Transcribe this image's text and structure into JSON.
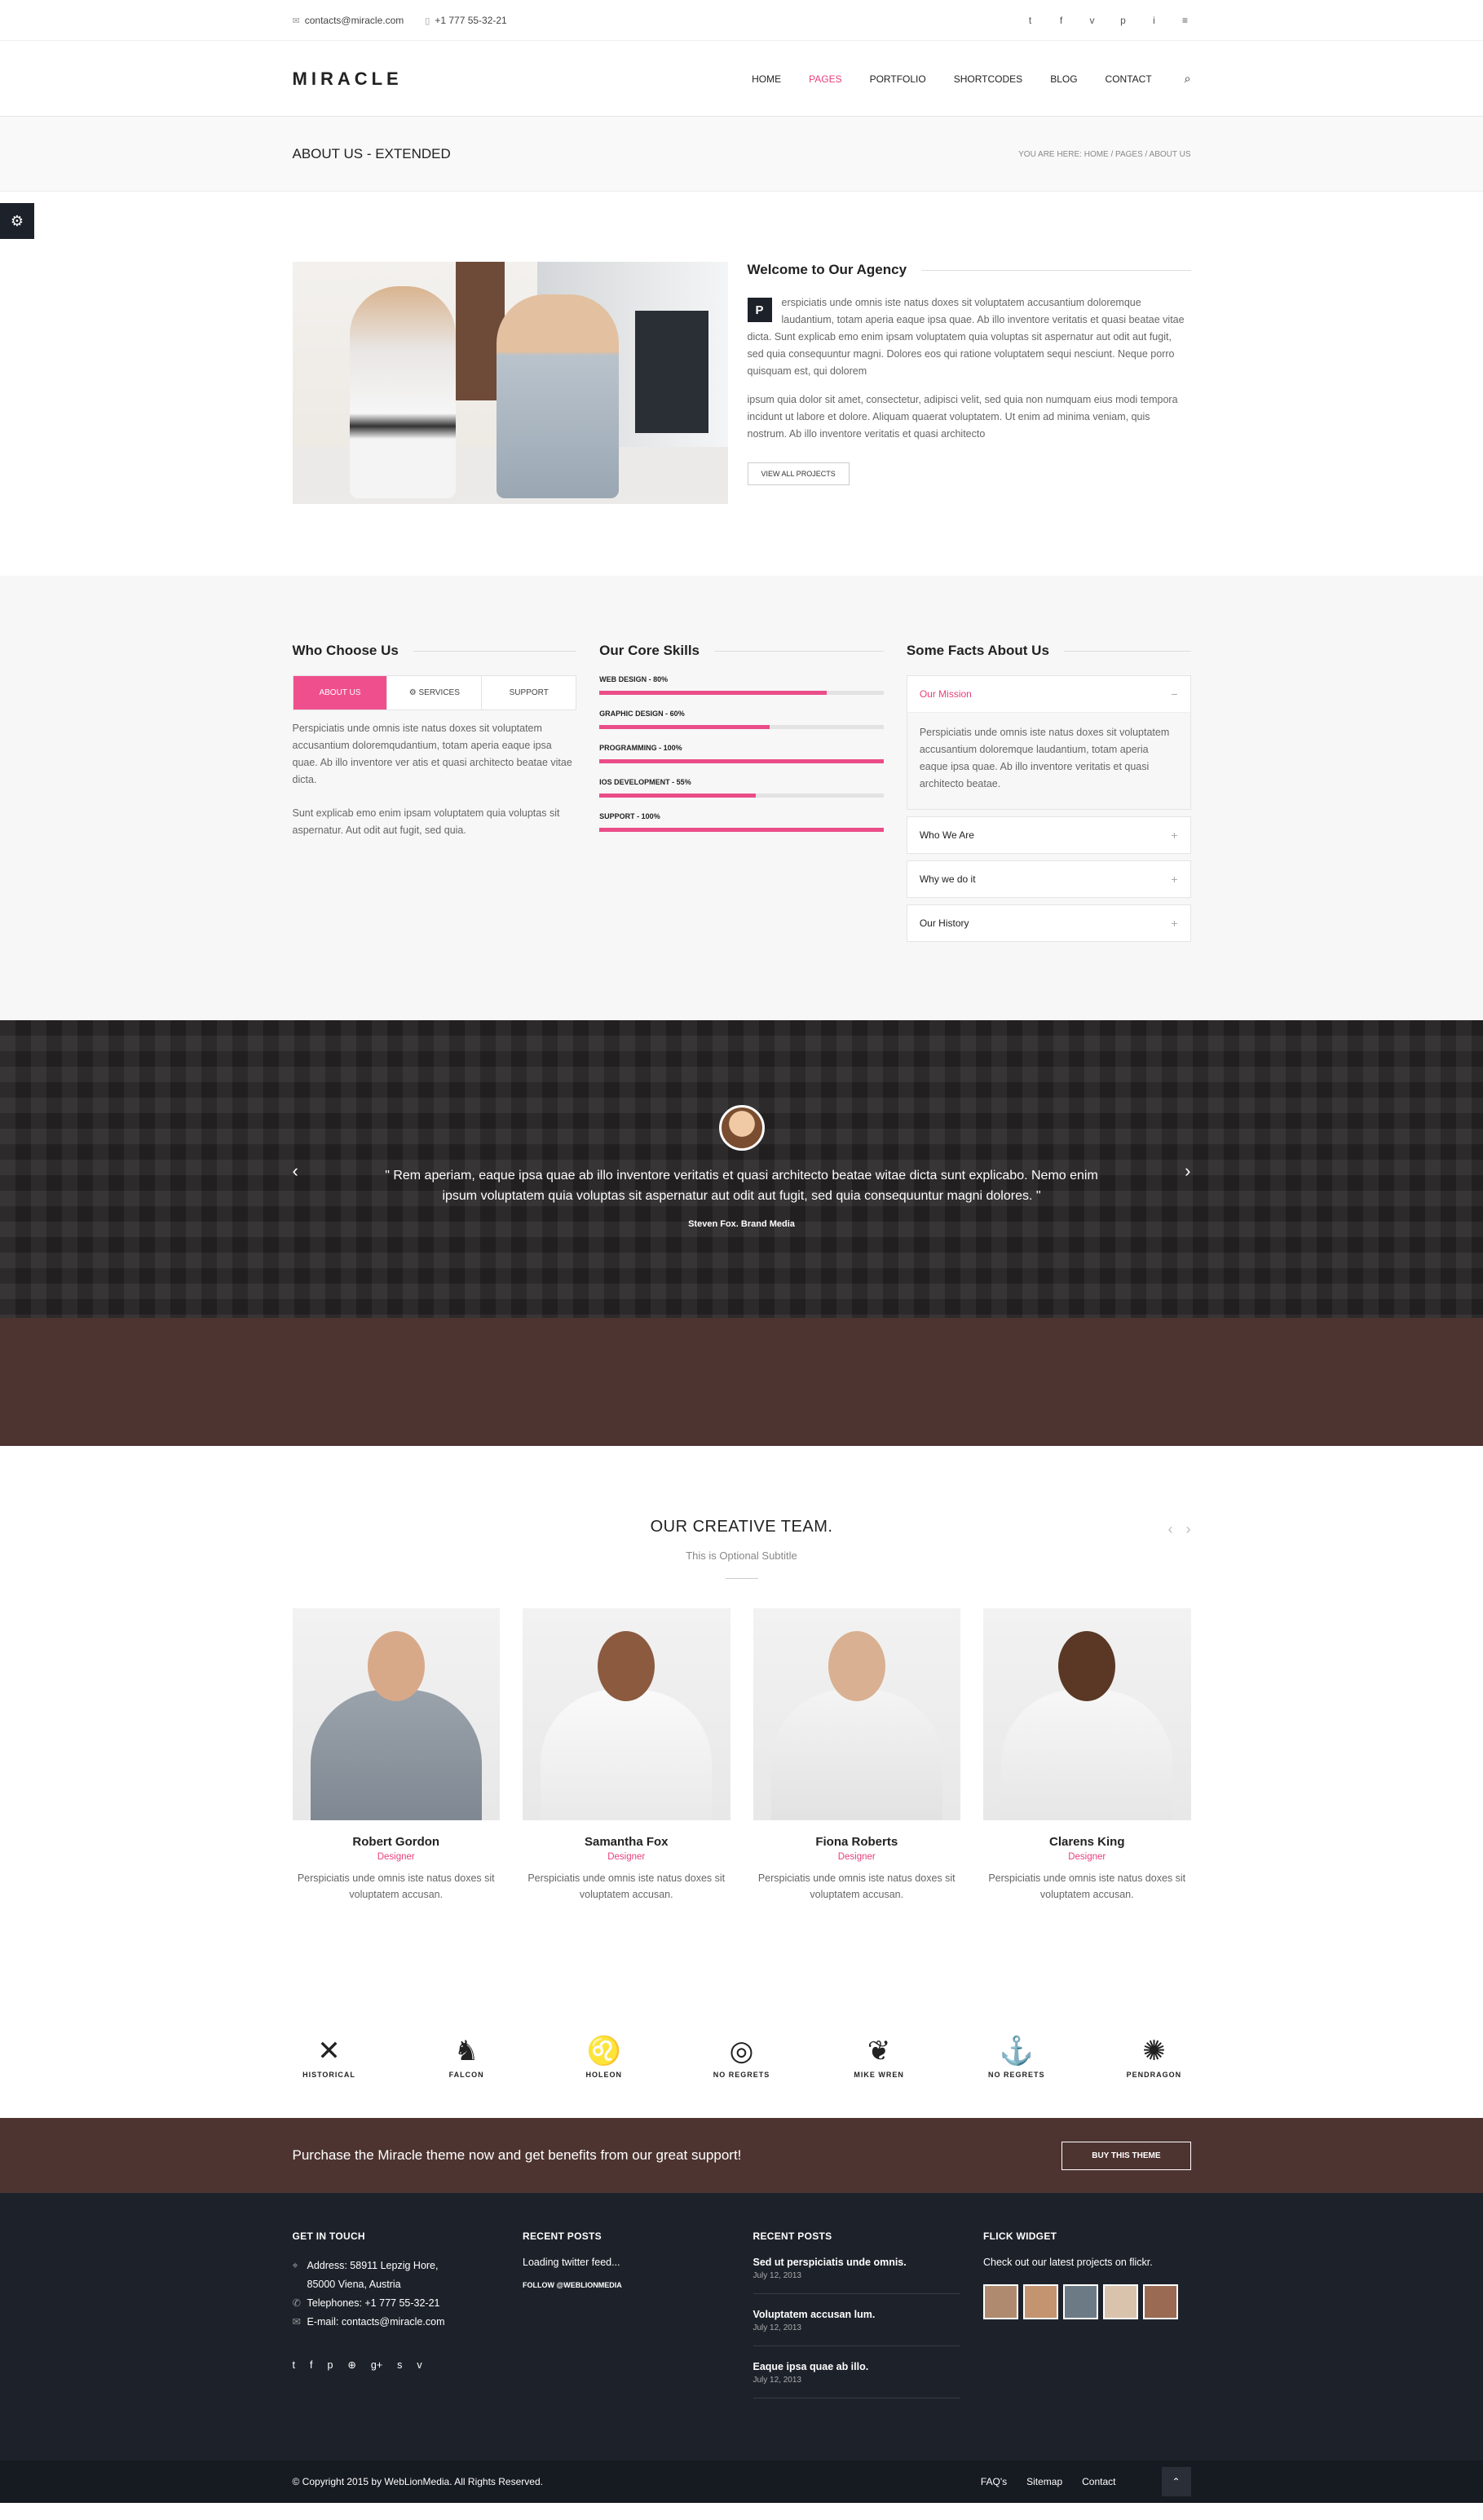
{
  "topbar": {
    "email": "contacts@miracle.com",
    "phone": "+1 777 55-32-21",
    "social": [
      "t",
      "f",
      "v",
      "p",
      "i",
      "≡"
    ]
  },
  "header": {
    "logo": "MIRACLE",
    "nav": [
      "HOME",
      "PAGES",
      "PORTFOLIO",
      "SHORTCODES",
      "BLOG",
      "CONTACT"
    ],
    "active": "PAGES"
  },
  "titlebar": {
    "title": "ABOUT US - EXTENDED",
    "breadcrumb": "YOU ARE HERE: HOME / PAGES / ABOUT US"
  },
  "about": {
    "title": "Welcome to Our Agency",
    "dropcap": "P",
    "para1": "erspiciatis unde omnis iste natus doxes sit voluptatem accusantium doloremque laudantium, totam aperia eaque ipsa quae. Ab illo inventore veritatis et quasi beatae vitae dicta. Sunt explicab emo enim ipsam voluptatem quia voluptas sit aspernatur aut odit aut fugit, sed quia consequuntur magni. Dolores eos qui ratione voluptatem sequi nesciunt. Neque porro quisquam est, qui dolorem",
    "para2": "ipsum quia dolor sit amet, consectetur, adipisci velit, sed quia non numquam eius modi tempora incidunt ut labore et dolore. Aliquam quaerat voluptatem. Ut enim ad minima veniam, quis nostrum. Ab illo inventore veritatis et quasi architecto",
    "button": "VIEW ALL PROJECTS"
  },
  "features": {
    "who": {
      "title": "Who Choose Us",
      "tabs": [
        "ABOUT US",
        "⚙ SERVICES",
        "SUPPORT"
      ],
      "p1": "Perspiciatis unde omnis iste natus doxes sit voluptatem accusantium doloremqudantium, totam aperia eaque ipsa quae. Ab illo inventore ver atis et quasi architecto beatae vitae dicta.",
      "p2": "Sunt explicab emo enim ipsam voluptatem quia voluptas sit aspernatur. Aut odit aut fugit, sed quia."
    },
    "skills": {
      "title": "Our Core Skills",
      "items": [
        {
          "label": "WEB DESIGN - 80%",
          "value": 80
        },
        {
          "label": "GRAPHIC DESIGN - 60%",
          "value": 60
        },
        {
          "label": "PROGRAMMING - 100%",
          "value": 100
        },
        {
          "label": "IOS DEVELOPMENT - 55%",
          "value": 55
        },
        {
          "label": "SUPPORT - 100%",
          "value": 100
        }
      ]
    },
    "facts": {
      "title": "Some Facts About Us",
      "open": "Our Mission",
      "open_body": "Perspiciatis unde omnis iste natus doxes sit voluptatem accusantium doloremque laudantium, totam aperia eaque ipsa quae. Ab illo inventore veritatis et quasi architecto beatae.",
      "closed": [
        "Who We Are",
        "Why we do it",
        "Our History"
      ]
    }
  },
  "testimonial": {
    "quote": "\" Rem aperiam, eaque ipsa quae ab illo inventore veritatis et quasi architecto beatae witae dicta sunt explicabo. Nemo enim ipsum voluptatem quia voluptas sit aspernatur aut odit aut fugit, sed quia consequuntur magni dolores. \"",
    "author": "Steven Fox. Brand Media"
  },
  "team": {
    "title": "OUR CREATIVE TEAM.",
    "subtitle": "This is Optional Subtitle",
    "members": [
      {
        "name": "Robert Gordon",
        "role": "Designer",
        "desc": "Perspiciatis unde omnis iste natus doxes sit voluptatem accusan."
      },
      {
        "name": "Samantha Fox",
        "role": "Designer",
        "desc": "Perspiciatis unde omnis iste natus doxes sit voluptatem accusan."
      },
      {
        "name": "Fiona Roberts",
        "role": "Designer",
        "desc": "Perspiciatis unde omnis iste natus doxes sit voluptatem accusan."
      },
      {
        "name": "Clarens King",
        "role": "Designer",
        "desc": "Perspiciatis unde omnis iste natus doxes sit voluptatem accusan."
      }
    ]
  },
  "logos": [
    {
      "mark": "✕",
      "name": "HISTORICAL"
    },
    {
      "mark": "♞",
      "name": "FALCON"
    },
    {
      "mark": "♌",
      "name": "HOLEON"
    },
    {
      "mark": "◎",
      "name": "NO REGRETS"
    },
    {
      "mark": "❦",
      "name": "MIKE WREN"
    },
    {
      "mark": "⚓",
      "name": "NO REGRETS"
    },
    {
      "mark": "✺",
      "name": "PENDRAGON"
    }
  ],
  "cta": {
    "text": "Purchase the Miracle theme now and get benefits from our great support!",
    "button": "BUY THIS THEME"
  },
  "footer": {
    "contact": {
      "title": "GET IN TOUCH",
      "address1": "Address: 58911 Lepzig Hore,",
      "address2": "85000 Viena, Austria",
      "phone": "Telephones: +1 777 55-32-21",
      "email": "E-mail: contacts@miracle.com",
      "social": [
        "t",
        "f",
        "p",
        "⊕",
        "g+",
        "s",
        "v"
      ]
    },
    "twitter": {
      "title": "RECENT POSTS",
      "loading": "Loading twitter feed...",
      "follow": "FOLLOW @WEBLIONMEDIA"
    },
    "posts": {
      "title": "RECENT POSTS",
      "items": [
        {
          "title": "Sed ut perspiciatis unde omnis.",
          "date": "July 12, 2013"
        },
        {
          "title": "Voluptatem accusan lum.",
          "date": "July 12, 2013"
        },
        {
          "title": "Eaque ipsa quae ab illo.",
          "date": "July 12, 2013"
        }
      ]
    },
    "flickr": {
      "title": "FLICK WIDGET",
      "text": "Check out our latest projects on flickr.",
      "colors": [
        "#b08a6e",
        "#c4936f",
        "#6c7a86",
        "#d9c3ad",
        "#9a6a52"
      ]
    }
  },
  "copyright": {
    "text": "© Copyright 2015 by WebLionMedia. All Rights Reserved.",
    "links": [
      "FAQ's",
      "Sitemap",
      "Contact"
    ]
  }
}
